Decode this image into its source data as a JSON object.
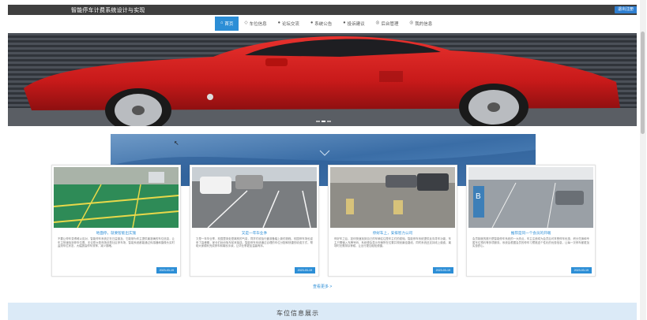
{
  "header": {
    "site_title": "智能停车计费系统设计与实现",
    "login_label": "退出注册"
  },
  "nav": {
    "items": [
      {
        "icon": "home-icon",
        "glyph": "⌂",
        "label": "首页",
        "active": true
      },
      {
        "icon": "info-icon",
        "glyph": "◇",
        "label": "车位信息",
        "active": false
      },
      {
        "icon": "news-icon",
        "glyph": "●",
        "label": "论坛交流",
        "active": false
      },
      {
        "icon": "notice-icon",
        "glyph": "●",
        "label": "系统公告",
        "active": false
      },
      {
        "icon": "feedback-icon",
        "glyph": "●",
        "label": "投诉建议",
        "active": false
      },
      {
        "icon": "user-icon",
        "glyph": "◎",
        "label": "后台管理",
        "active": false
      },
      {
        "icon": "profile-icon",
        "glyph": "◎",
        "label": "我的信息",
        "active": false
      }
    ]
  },
  "carousel": {
    "slides": 3,
    "active_index": 1,
    "colors": {
      "car": "#d21f1f",
      "wall": "#3a3e45"
    }
  },
  "news": {
    "cards": [
      {
        "title": "地面停，就要智能出实施",
        "desc": "不要让停车变得难以应对，智能停车系统正在日益普及，它能够为车主提供最准确的车位信息，让车主快速找到停车位置。无论是大型商场还是社区停车场，智能系统都能通过传感器和摄像头实时监测车位状态，大幅提高停车效率，减少拥堵。",
        "date": "2023-03-19"
      },
      {
        "title": "又是一年毕业季",
        "desc": "又是一年毕业季，校园里到处是离别的气息，同学们收拾行囊准备踏上新的旅程。校园停车场也迎来了高峰期，家长们纷纷驾车前来接送。智能停车系统通过合理的车位分配和快捷的收费方式，帮助大家顺利完成停车和离校手续，让毕业季更加温馨有序。",
        "date": "2023-03-19"
      },
      {
        "title": "停好车上，安排智力公司",
        "desc": "停好车之后，如何快速找到自己的车辆往往是车主们的烦恼。智能停车系统提供反向寻车功能，车主只需输入车牌号码，系统便会显示车辆所在位置并规划最佳路线，同时系统还支持线上缴费，离场时无需排队等候，让出行更加轻松便捷。",
        "date": "2023-03-19"
      },
      {
        "title": "推荐是同一个会员的开端",
        "desc": "会员制度的推行是智能停车系统的一大亮点，车主注册成为会员后可享受停车优惠、积分兑换和专属车位预约等多项服务。系统会根据会员的停车习惯推送个性化的优惠信息，让每一次停车都更加实惠舒心。",
        "date": "2023-03-19"
      }
    ],
    "more_label": "查看更多 >"
  },
  "section2": {
    "title": "车位信息展示"
  }
}
